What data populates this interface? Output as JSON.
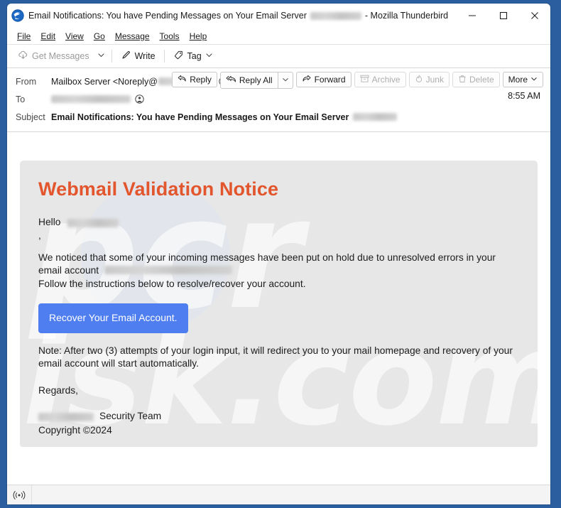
{
  "window": {
    "title_prefix": "Email Notifications: You have Pending Messages on Your Email Server",
    "title_suffix": "- Mozilla Thunderbird",
    "app_icon": "thunderbird-icon",
    "minimize_label": "Minimize",
    "maximize_label": "Maximize",
    "close_label": "Close"
  },
  "menubar": {
    "items": [
      {
        "label": "File"
      },
      {
        "label": "Edit"
      },
      {
        "label": "View"
      },
      {
        "label": "Go"
      },
      {
        "label": "Message"
      },
      {
        "label": "Tools"
      },
      {
        "label": "Help"
      }
    ]
  },
  "toolbar": {
    "get_messages_label": "Get Messages",
    "get_messages_icon": "cloud-download-icon",
    "get_messages_caret_icon": "chevron-down-icon",
    "write_label": "Write",
    "write_icon": "pencil-icon",
    "tag_label": "Tag",
    "tag_icon": "tag-icon",
    "tag_caret_icon": "chevron-down-icon"
  },
  "message_header": {
    "from_label": "From",
    "from_value_prefix": "Mailbox Server <Noreply@",
    "from_value_suffix": ">",
    "from_avatar_icon": "contact-avatar-icon",
    "to_label": "To",
    "to_avatar_icon": "contact-avatar-icon",
    "subject_label": "Subject",
    "subject_value": "Email Notifications: You have Pending Messages on Your Email Server",
    "time": "8:55 AM"
  },
  "message_actions": {
    "reply_label": "Reply",
    "reply_icon": "reply-icon",
    "reply_all_label": "Reply All",
    "reply_all_icon": "reply-all-icon",
    "reply_all_caret_icon": "chevron-down-icon",
    "forward_label": "Forward",
    "forward_icon": "forward-icon",
    "archive_label": "Archive",
    "archive_icon": "archive-box-icon",
    "junk_label": "Junk",
    "junk_icon": "junk-flame-icon",
    "delete_label": "Delete",
    "delete_icon": "trash-icon",
    "more_label": "More",
    "more_caret_icon": "chevron-down-icon"
  },
  "email_body": {
    "title": "Webmail Validation Notice",
    "greeting": "Hello",
    "greeting_comma": ",",
    "paragraph_1_line_1": "We noticed that some of your incoming messages have been put on hold due to unresolved errors in your",
    "paragraph_1_line_2": "email account",
    "paragraph_2": "Follow the instructions below to resolve/recover your account.",
    "cta_button_label": "Recover Your Email Account.",
    "note": "Note: After two (3) attempts of your login input, it will redirect you to your mail homepage and recovery of your email account will start automatically.",
    "regards": "Regards,",
    "signature_suffix": "Security Team",
    "copyright": "Copyright  ©2024",
    "watermark_line_1": "pcr",
    "watermark_line_2": "isk.com",
    "title_color": "#e2552d",
    "cta_color": "#4f7ef0",
    "body_background": "#e7e7e7"
  },
  "statusbar": {
    "connection_icon": "wireless-signal-icon",
    "text": ""
  }
}
